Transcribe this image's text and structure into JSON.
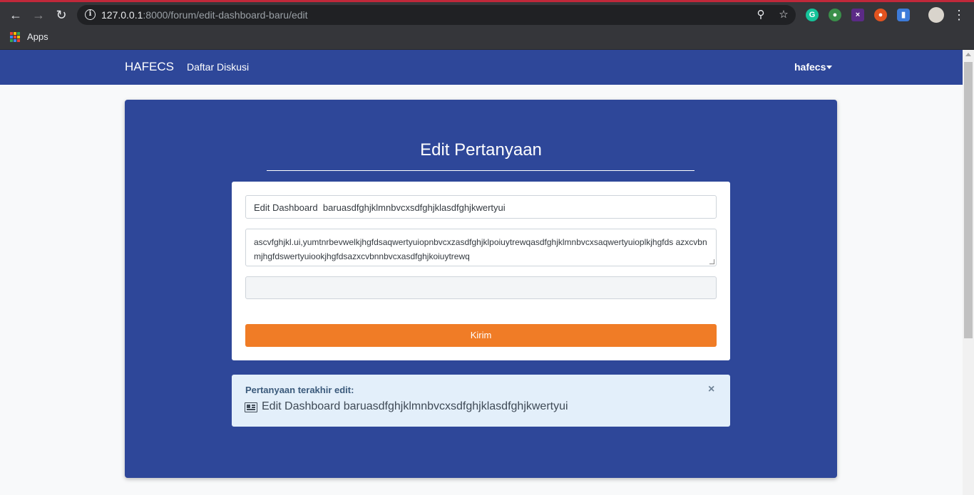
{
  "browser": {
    "url_host": "127.0.0.1",
    "url_rest": ":8000/forum/edit-dashboard-baru/edit",
    "bookmark_apps_label": "Apps"
  },
  "navbar": {
    "brand": "HAFECS",
    "nav_link": "Daftar Diskusi",
    "user": "hafecs"
  },
  "form": {
    "heading": "Edit Pertanyaan",
    "title_value": "Edit Dashboard  baruasdfghjklmnbvcxsdfghjklasdfghjkwertyui",
    "body_value": "ascvfghjkl.ui,yumtnrbevwelkjhgfdsaqwertyuiopnbvcxzasdfghjklpoiuytrewqasdfghjklmnbvcxsaqwertyuioplkjhgfds azxcvbnmjhgfdswertyuiookjhgfdsazxcvbnnbvcxasdfghjkoiuytrewq",
    "tags_value": "",
    "submit_label": "Kirim"
  },
  "alert": {
    "label": "Pertanyaan terakhir edit:",
    "close": "×",
    "text": "Edit Dashboard baruasdfghjklmnbvcxsdfghjklasdfghjkwertyui"
  },
  "colors": {
    "navbar_bg": "#2e4799",
    "button_bg": "#f07c26",
    "alert_bg": "#e3effa"
  }
}
